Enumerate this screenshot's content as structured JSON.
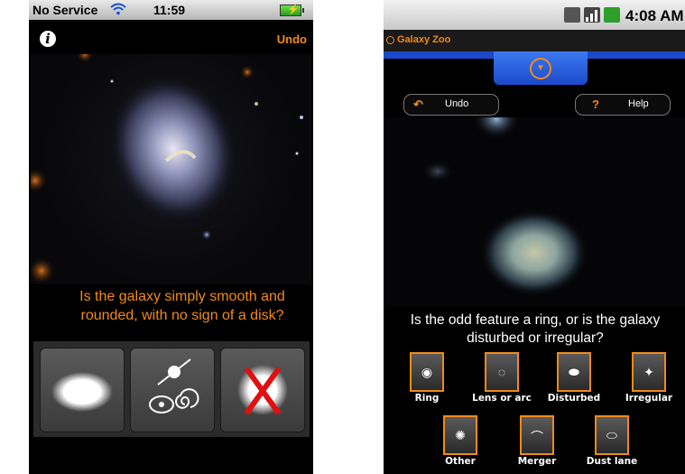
{
  "iphone": {
    "status": {
      "carrier": "No Service",
      "time": "11:59"
    },
    "undo_label": "Undo",
    "question": "Is the galaxy simply smooth and rounded, with no sign of a disk?",
    "answers": [
      {
        "name": "smooth",
        "icon": "smooth-ellipse-icon"
      },
      {
        "name": "features-or-disk",
        "icon": "disk-and-spiral-icon"
      },
      {
        "name": "star-or-artifact",
        "icon": "red-x-icon"
      }
    ]
  },
  "android": {
    "status": {
      "time": "4:08 AM"
    },
    "app_title": "Galaxy Zoo",
    "undo_label": "Undo",
    "help_label": "Help",
    "question": "Is the odd feature a ring, or is the galaxy disturbed or irregular?",
    "options": [
      {
        "label": "Ring",
        "icon": "eye-icon"
      },
      {
        "label": "Lens or arc",
        "icon": "arc-icon"
      },
      {
        "label": "Disturbed",
        "icon": "disturbed-icon"
      },
      {
        "label": "Irregular",
        "icon": "irregular-icon"
      },
      {
        "label": "Other",
        "icon": "other-icon"
      },
      {
        "label": "Merger",
        "icon": "merger-icon"
      },
      {
        "label": "Dust lane",
        "icon": "dust-lane-icon"
      }
    ],
    "colors": {
      "accent": "#f28a1b",
      "tab": "#1d48c9"
    }
  }
}
